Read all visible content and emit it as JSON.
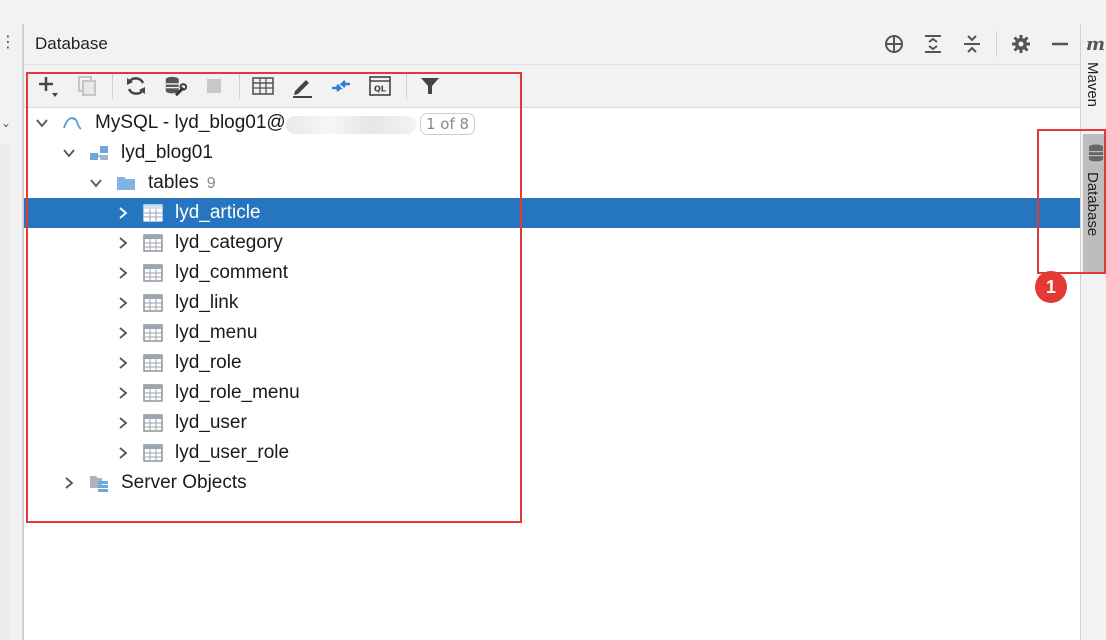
{
  "panel": {
    "title": "Database",
    "header_icons": [
      "crosshair-icon",
      "expand-all-icon",
      "collapse-all-icon",
      "gear-icon",
      "minimize-icon"
    ]
  },
  "toolbar": {
    "icons": [
      "add-icon",
      "copy-icon",
      "refresh-icon",
      "data-source-properties-icon",
      "stop-icon",
      "table-icon",
      "edit-icon",
      "jump-to-console-icon",
      "query-console-icon",
      "filter-icon"
    ]
  },
  "tree": {
    "connection": {
      "label": "MySQL - lyd_blog01@",
      "badge": "1 of 8"
    },
    "schema": {
      "label": "lyd_blog01"
    },
    "tables_folder": {
      "label": "tables",
      "count": "9"
    },
    "tables": [
      "lyd_article",
      "lyd_category",
      "lyd_comment",
      "lyd_link",
      "lyd_menu",
      "lyd_role",
      "lyd_role_menu",
      "lyd_user",
      "lyd_user_role"
    ],
    "selected_table": "lyd_article",
    "server_objects": {
      "label": "Server Objects"
    }
  },
  "right_stripe": {
    "maven_label": "Maven",
    "maven_glyph": "m",
    "database_label": "Database"
  },
  "annotation": {
    "marker_number": "1",
    "color": "#e53935"
  },
  "colors": {
    "selection": "#2675bf",
    "folder": "#7fb4e4"
  }
}
